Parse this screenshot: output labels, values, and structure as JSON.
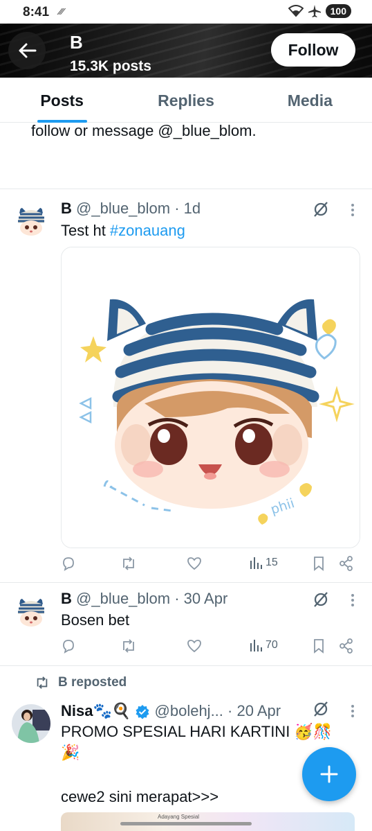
{
  "status": {
    "time": "8:41",
    "battery": "100"
  },
  "header": {
    "name": "B",
    "posts": "15.3K posts",
    "follow_label": "Follow"
  },
  "tabs": [
    {
      "label": "Posts",
      "active": true
    },
    {
      "label": "Replies",
      "active": false
    },
    {
      "label": "Media",
      "active": false
    }
  ],
  "previous_tweet_tail": "follow or message @_blue_blom.",
  "tweets": [
    {
      "name": "B",
      "handle": "@_blue_blom",
      "time": "· 1d",
      "text": "Test ht ",
      "hashtag": "#zonauang",
      "media_watermark": "phii",
      "views": "15"
    },
    {
      "name": "B",
      "handle": "@_blue_blom",
      "time": "· 30 Apr",
      "text": "Bosen bet",
      "views": "70"
    }
  ],
  "repost": {
    "label": "B reposted",
    "name": "Nisa🐾🍳",
    "handle": "@bolehj...",
    "time": "· 20 Apr",
    "line1": "PROMO SPESIAL HARI KARTINI 🥳🎊",
    "line2": "🎉",
    "line3": "cewe2 sini merapat>>>",
    "preview_text": "Adayang Spesial"
  },
  "colors": {
    "accent": "#1d9bf0",
    "secondary_text": "#536471"
  }
}
